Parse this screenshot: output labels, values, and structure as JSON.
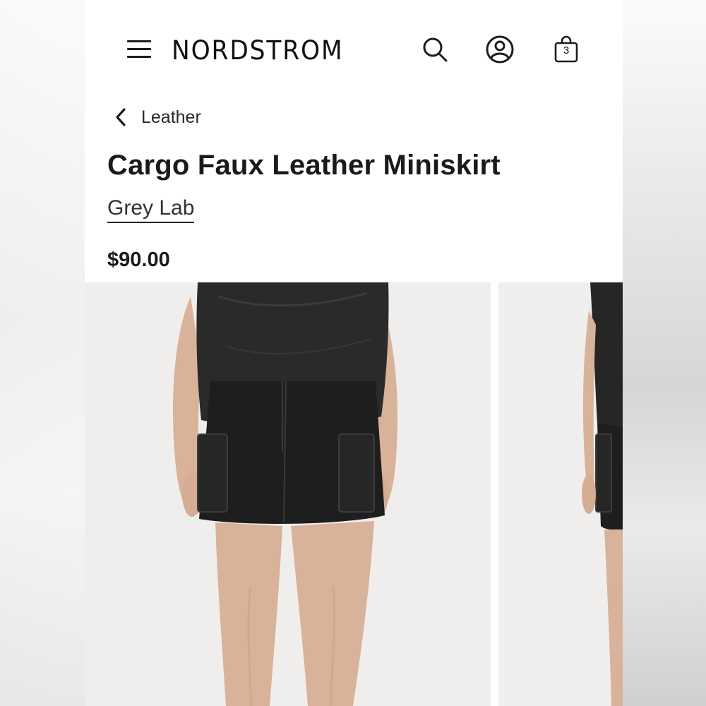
{
  "header": {
    "logo": "NORDSTROM",
    "icons": [
      "menu-icon",
      "search-icon",
      "account-icon",
      "shopping-bag-icon"
    ],
    "bag_count": "3"
  },
  "breadcrumb": {
    "label": "Leather"
  },
  "product": {
    "title": "Cargo Faux Leather Miniskirt",
    "brand": "Grey Lab",
    "price": "$90.00"
  },
  "colors": {
    "text": "#1d1d1d",
    "background": "#ffffff",
    "photo_bg": "#efeeed"
  }
}
